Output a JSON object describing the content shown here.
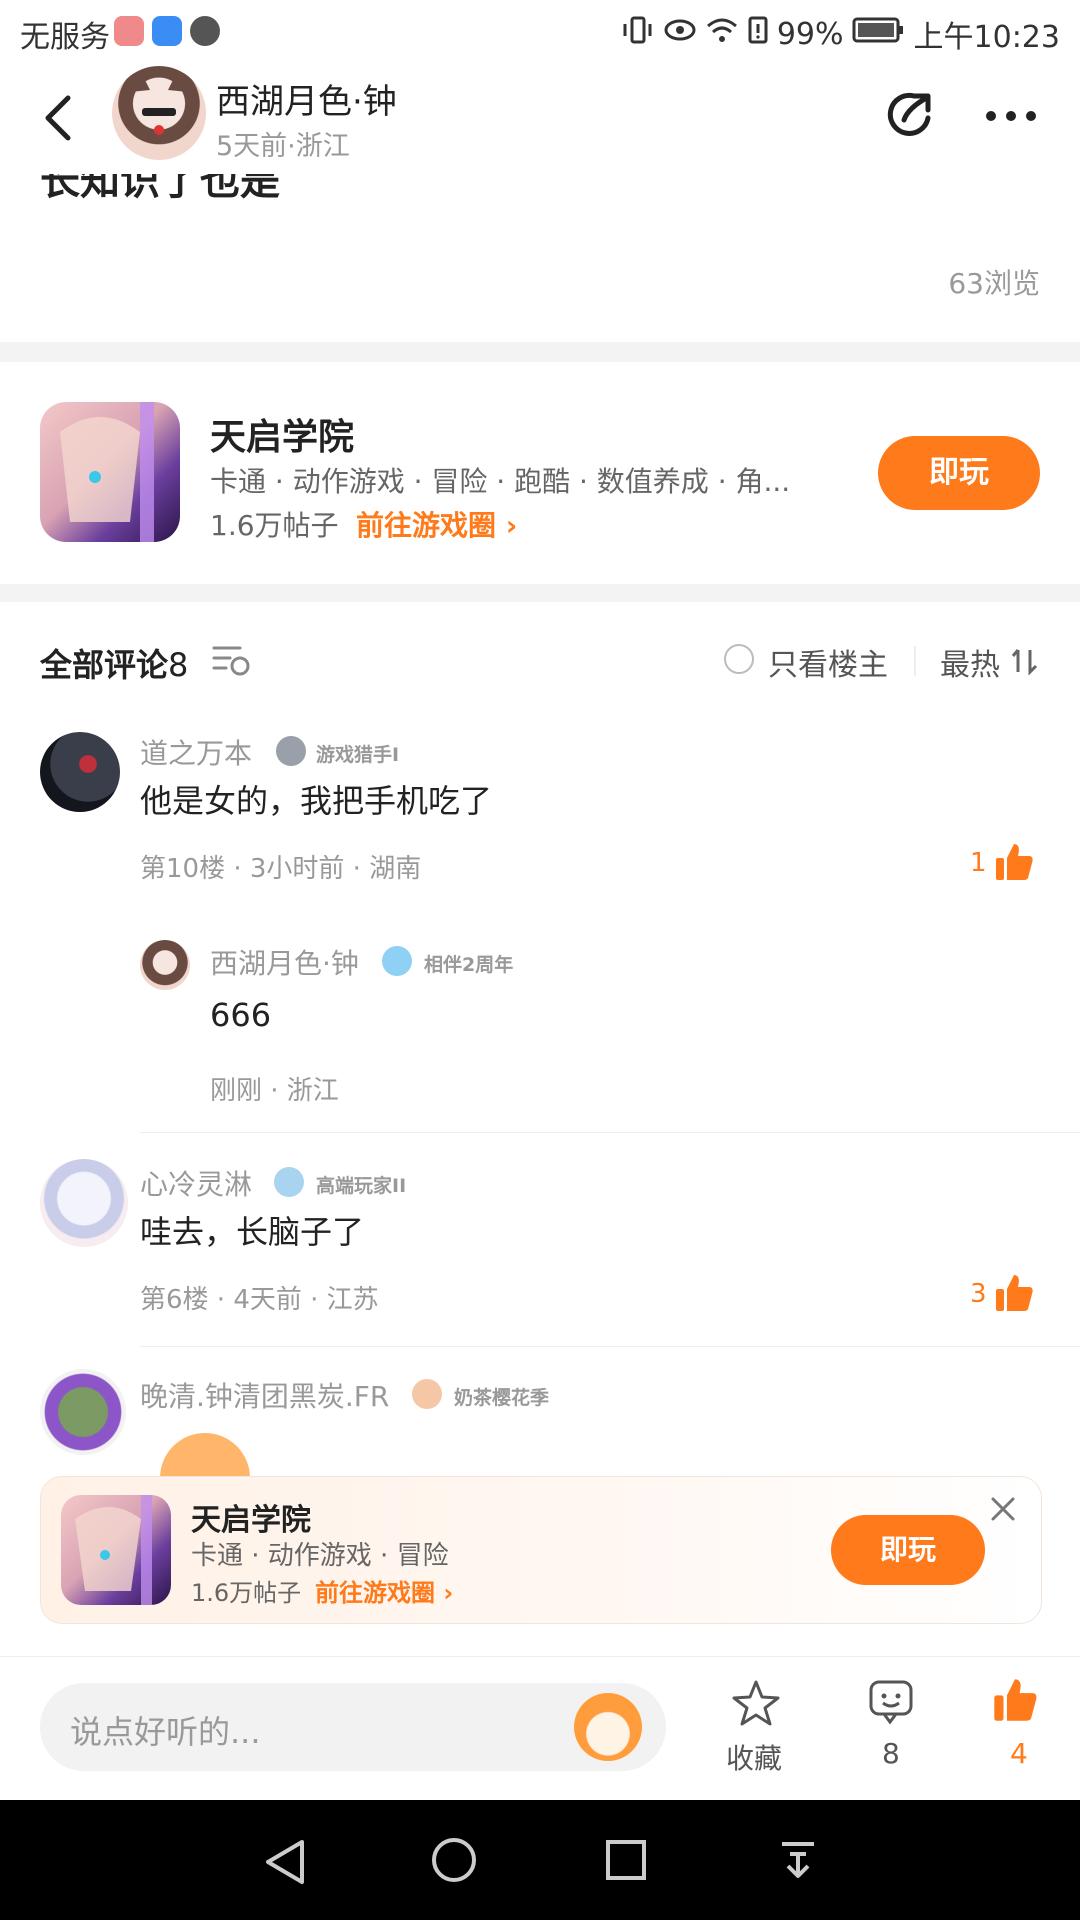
{
  "status_bar": {
    "carrier": "无服务",
    "battery": "99%",
    "time": "上午10:23"
  },
  "header": {
    "author_name": "西湖月色·钟",
    "post_meta": "5天前·浙江"
  },
  "post": {
    "partial_text": "长知识了也是",
    "views": "63浏览"
  },
  "game_card": {
    "title": "天启学院",
    "tags": "卡通 · 动作游戏 · 冒险 · 跑酷 · 数值养成 · 角...",
    "posts_count": "1.6万帖子",
    "goto_circle": "前往游戏圈",
    "play_label": "即玩"
  },
  "comments_section": {
    "title": "全部评论",
    "count": "8",
    "only_op_label": "只看楼主",
    "sort_label": "最热"
  },
  "comments": [
    {
      "author": "道之万本",
      "badge": "游戏猎手I",
      "text": "他是女的，我把手机吃了",
      "meta": "第10楼 · 3小时前 · 湖南",
      "likes": "1"
    },
    {
      "author": "心冷灵淋",
      "badge": "高端玩家II",
      "text": "哇去，长脑子了",
      "meta": "第6楼 · 4天前 · 江苏",
      "likes": "3"
    },
    {
      "author": "晚清.钟清团黑炭.FR",
      "badge": "奶茶樱花季"
    }
  ],
  "reply": {
    "author": "西湖月色·钟",
    "badge": "相伴2周年",
    "text": "666",
    "meta": "刚刚 · 浙江"
  },
  "float_card": {
    "title": "天启学院",
    "tags": "卡通 · 动作游戏 · 冒险",
    "posts_count": "1.6万帖子",
    "goto_circle": "前往游戏圈",
    "play_label": "即玩"
  },
  "bottom_bar": {
    "input_placeholder": "说点好听的...",
    "favorite_label": "收藏",
    "comment_count": "8",
    "like_count": "4"
  },
  "colors": {
    "accent": "#ff7a1a",
    "text": "#222222",
    "muted": "#999999",
    "nav_bar": "#000000"
  }
}
